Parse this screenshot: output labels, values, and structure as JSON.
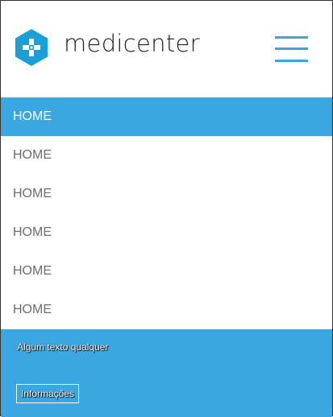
{
  "brand": {
    "name": "medicenter",
    "accent_color": "#3ba7e0",
    "logo_icon": "hexagon-plus-icon"
  },
  "header": {
    "menu_icon": "hamburger-menu-icon"
  },
  "nav": {
    "items": [
      {
        "label": "HOME",
        "active": true
      },
      {
        "label": "HOME",
        "active": false
      },
      {
        "label": "HOME",
        "active": false
      },
      {
        "label": "HOME",
        "active": false
      },
      {
        "label": "HOME",
        "active": false
      },
      {
        "label": "HOME",
        "active": false
      }
    ]
  },
  "footer": {
    "text": "Algum texto qualquer",
    "button_label": "Informações"
  }
}
